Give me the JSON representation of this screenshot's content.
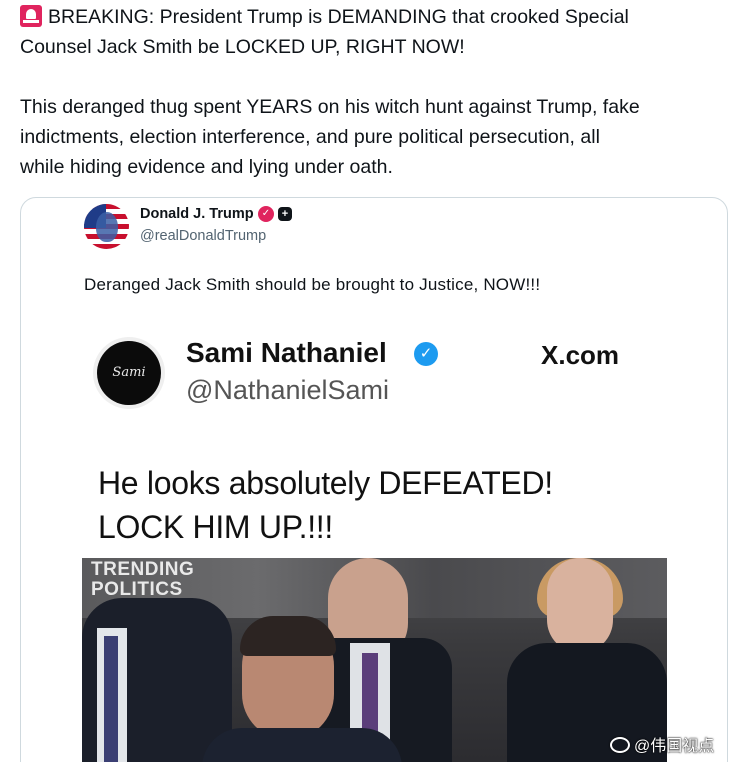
{
  "post": {
    "line1": "BREAKING: President Trump is DEMANDING that crooked Special",
    "line2": "Counsel Jack Smith be LOCKED UP, RIGHT NOW!",
    "line3": "This deranged thug spent YEARS on his witch hunt against Trump, fake",
    "line4": "indictments, election interference, and pure political persecution, all",
    "line5": "while hiding evidence and lying under oath.",
    "icon": "siren-icon"
  },
  "quoted": {
    "name": "Donald J. Trump",
    "handle": "@realDonaldTrump",
    "text": "Deranged Jack Smith should be brought to Justice, NOW!!!"
  },
  "embedded": {
    "avatar_text": "Sami",
    "name": "Sami Nathaniel",
    "handle": "@NathanielSami",
    "site": "X.com",
    "text_line1": "He looks absolutely DEFEATED!",
    "text_line2": "LOCK HIM UP.!!!"
  },
  "video": {
    "logo_line1": "TRENDING",
    "logo_line2": "POLITICS"
  },
  "watermark": {
    "text": "@伟国视点"
  },
  "colors": {
    "verified": "#1d9bf0",
    "affiliate_badge": "#e0245e",
    "border": "#cfd9de",
    "secondary_text": "#536471"
  }
}
